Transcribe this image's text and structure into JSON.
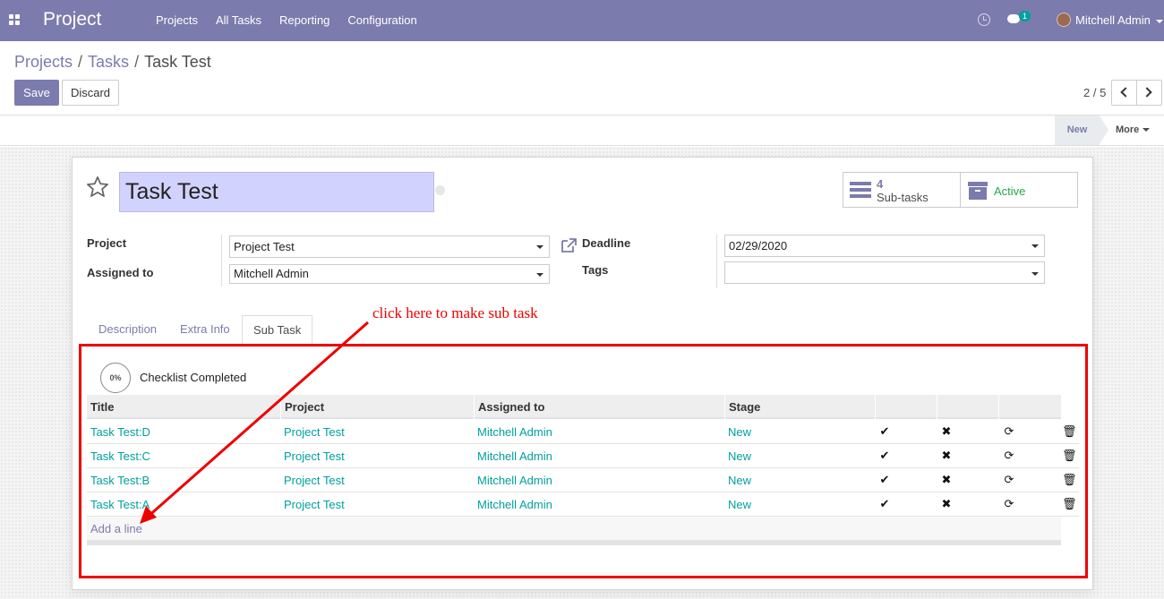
{
  "navbar": {
    "brand": "Project",
    "menu": [
      "Projects",
      "All Tasks",
      "Reporting",
      "Configuration"
    ],
    "chat_count": "1",
    "user": "Mitchell Admin"
  },
  "breadcrumb": {
    "projects": "Projects",
    "tasks": "Tasks",
    "current": "Task Test",
    "sep": "/"
  },
  "toolbar": {
    "save_label": "Save",
    "discard_label": "Discard"
  },
  "pager": {
    "value": "2 / 5"
  },
  "statusbar": {
    "stage": "New",
    "more_label": "More"
  },
  "form": {
    "title": "Task Test",
    "smart_buttons": {
      "subtasks_count": "4",
      "subtasks_label": "Sub-tasks",
      "active_label": "Active"
    },
    "fields": {
      "project_label": "Project",
      "project_value": "Project Test",
      "assigned_label": "Assigned to",
      "assigned_value": "Mitchell Admin",
      "deadline_label": "Deadline",
      "deadline_value": "02/29/2020",
      "tags_label": "Tags",
      "tags_value": ""
    },
    "tabs": [
      "Description",
      "Extra Info",
      "Sub Task"
    ]
  },
  "annotation": {
    "text": "click here to make sub task",
    "color": "#e00000"
  },
  "checklist": {
    "percent": "0%",
    "label": "Checklist Completed"
  },
  "subtasks_table": {
    "headers": [
      "Title",
      "Project",
      "Assigned to",
      "Stage"
    ],
    "rows": [
      {
        "title": "Task Test:D",
        "project": "Project Test",
        "assigned": "Mitchell Admin",
        "stage": "New"
      },
      {
        "title": "Task Test:C",
        "project": "Project Test",
        "assigned": "Mitchell Admin",
        "stage": "New"
      },
      {
        "title": "Task Test:B",
        "project": "Project Test",
        "assigned": "Mitchell Admin",
        "stage": "New"
      },
      {
        "title": "Task Test:A",
        "project": "Project Test",
        "assigned": "Mitchell Admin",
        "stage": "New"
      }
    ],
    "row_icons": [
      "check-icon",
      "cross-icon",
      "refresh-icon",
      "trash-icon"
    ],
    "add_line": "Add a line"
  },
  "colors": {
    "brand": "#7c7bad",
    "link": "#00a09d",
    "active": "#28a745"
  }
}
